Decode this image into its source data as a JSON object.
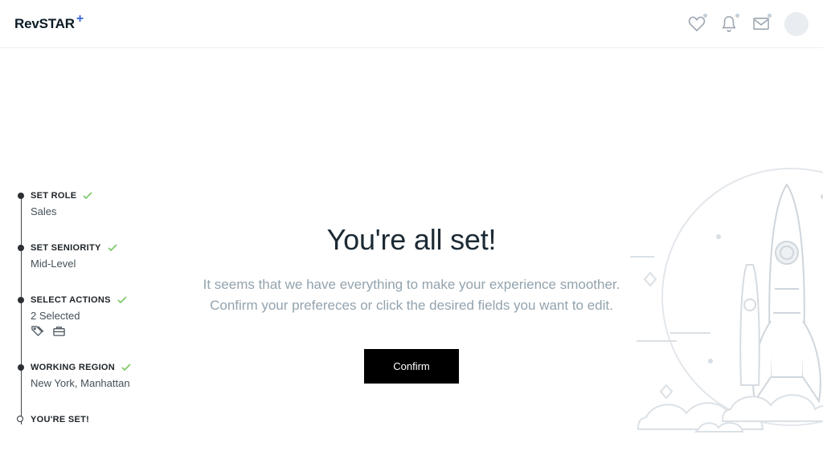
{
  "logo": {
    "text": "RevSTAR",
    "plus": "+"
  },
  "headerIcons": {
    "heart": "heart-icon",
    "bell": "bell-icon",
    "mail": "mail-icon",
    "avatar": "avatar"
  },
  "steps": {
    "role": {
      "title": "SET ROLE",
      "value": "Sales",
      "done": true
    },
    "seniority": {
      "title": "SET SENIORITY",
      "value": "Mid-Level",
      "done": true
    },
    "actions": {
      "title": "SELECT ACTIONS",
      "value": "2 Selected",
      "done": true
    },
    "region": {
      "title": "WORKING REGION",
      "value": "New York, Manhattan",
      "done": true
    },
    "final": {
      "title": "YOU'RE SET!"
    }
  },
  "main": {
    "heading": "You're all set!",
    "line1": "It seems that we have everything to make your experience smoother.",
    "line2": "Confirm your prefereces or click the desired fields you want to edit.",
    "confirm": "Confirm"
  }
}
